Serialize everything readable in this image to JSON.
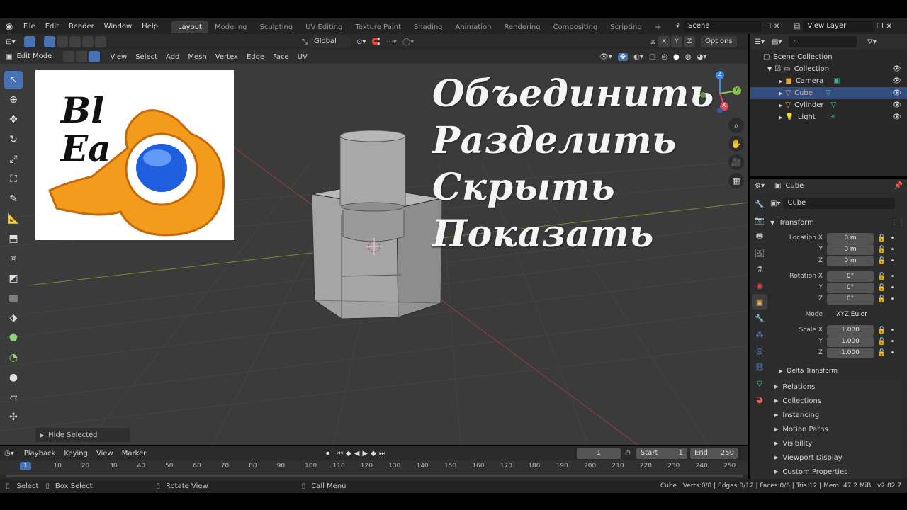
{
  "topbar": {
    "menu": [
      "File",
      "Edit",
      "Render",
      "Window",
      "Help"
    ],
    "workspaces": [
      "Layout",
      "Modeling",
      "Sculpting",
      "UV Editing",
      "Texture Paint",
      "Shading",
      "Animation",
      "Rendering",
      "Compositing",
      "Scripting"
    ],
    "active_workspace": "Layout",
    "add_tab": "+",
    "scene": "Scene",
    "view_layer": "View Layer"
  },
  "viewport": {
    "mode": "Edit Mode",
    "menus": [
      "View",
      "Select",
      "Add",
      "Mesh",
      "Vertex",
      "Edge",
      "Face",
      "UV"
    ],
    "transform_orientation": "Global",
    "options": "Options",
    "gizmo_axes": {
      "x": "X",
      "y": "Y",
      "z": "Z"
    },
    "overlay_words": [
      "Объединить",
      "Разделить",
      "Скрыть",
      "Показать"
    ],
    "logo_text": [
      "Bl",
      "Ea"
    ],
    "last_operator": "Hide Selected"
  },
  "outliner": {
    "search_placeholder": "",
    "root": "Scene Collection",
    "collection": "Collection",
    "items": [
      "Camera",
      "Cube",
      "Cylinder",
      "Light"
    ],
    "selected": "Cube"
  },
  "properties": {
    "object_name": "Cube",
    "object_field": "Cube",
    "transform_title": "Transform",
    "location": {
      "label_x": "Location X",
      "x": "0 m",
      "y": "0 m",
      "z": "0 m"
    },
    "rotation": {
      "label_x": "Rotation X",
      "x": "0°",
      "y": "0°",
      "z": "0°"
    },
    "mode_label": "Mode",
    "mode_value": "XYZ Euler",
    "scale": {
      "label_x": "Scale X",
      "x": "1.000",
      "y": "1.000",
      "z": "1.000"
    },
    "axis_labels": {
      "y": "Y",
      "z": "Z"
    },
    "delta": "Delta Transform",
    "panels": [
      "Relations",
      "Collections",
      "Instancing",
      "Motion Paths",
      "Visibility",
      "Viewport Display",
      "Custom Properties"
    ]
  },
  "timeline": {
    "menus": [
      "Playback",
      "Keying",
      "View",
      "Marker"
    ],
    "current_frame": "1",
    "start_label": "Start",
    "start": "1",
    "end_label": "End",
    "end": "250",
    "ruler": [
      "1",
      "10",
      "20",
      "30",
      "40",
      "50",
      "60",
      "70",
      "80",
      "90",
      "100",
      "110",
      "120",
      "130",
      "140",
      "150",
      "160",
      "170",
      "180",
      "190",
      "200",
      "210",
      "220",
      "230",
      "240",
      "250"
    ]
  },
  "statusbar": {
    "select": "Select",
    "box_select": "Box Select",
    "rotate_view": "Rotate View",
    "call_menu": "Call Menu",
    "stats": "Cube | Verts:0/8 | Edges:0/12 | Faces:0/6 | Tris:12 | Mem: 47.2 MiB | v2.82.7"
  },
  "colors": {
    "accent": "#4772b3",
    "selection": "#334d80",
    "logo_orange": "#f29b1d",
    "logo_blue": "#1e5fe0",
    "axis_x": "#e84a5f",
    "axis_y": "#8bc34a",
    "axis_z": "#3d8bf0"
  }
}
